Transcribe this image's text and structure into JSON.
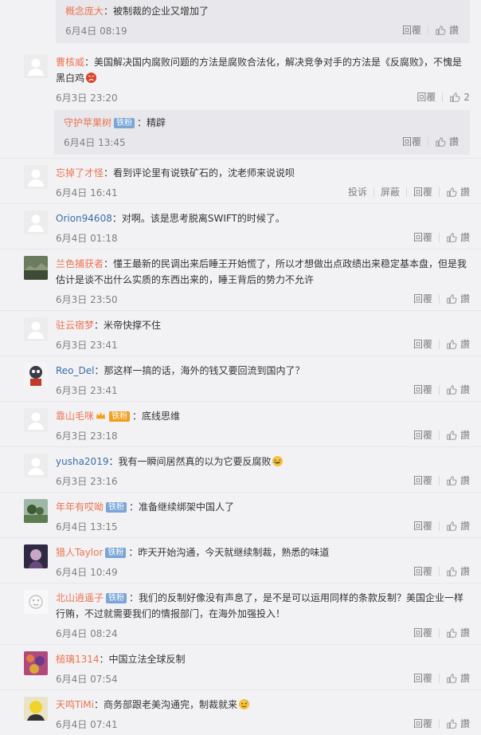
{
  "labels": {
    "reply": "回覆",
    "like": "讚",
    "report": "投诉",
    "block": "屏蔽"
  },
  "badge_iron_fan": "铁粉",
  "top_nested": {
    "user": "概念庞大",
    "text": "：被制裁的企业又增加了",
    "time": "6月4日 08:19"
  },
  "comments": [
    {
      "user": "曹核威",
      "text": "：美国解决国内腐败问题的方法是腐败合法化，解决竞争对手的方法是《反腐败》，不愧是黑白鸡",
      "time": "6月3日 23:20",
      "likes": "2",
      "nested": {
        "user": "守护苹果树",
        "text": "：精辟",
        "time": "6月4日 13:45"
      }
    },
    {
      "user": "忘掉了才怪",
      "text": "：看到评论里有说铁矿石的，沈老师来说说呗",
      "time": "6月4日 16:41"
    },
    {
      "user": "Orion94608",
      "text": "：对啊。该是思考脱离SWIFT的时候了。",
      "time": "6月4日 01:18"
    },
    {
      "user": "兰色捕获者",
      "text": "：懂王最新的民调出来后睡王开始慌了，所以才想做出点政绩出来稳定基本盘，但是我估计是谈不出什么实质的东西出来的，睡王背后的势力不允许",
      "time": "6月3日 23:50"
    },
    {
      "user": "驻云宿梦",
      "text": "：米帝快撑不住",
      "time": "6月3日 23:41"
    },
    {
      "user": "Reo_Del",
      "text": "：那这样一搞的话，海外的钱又要回流到国内了？",
      "time": "6月3日 23:41"
    },
    {
      "user": "靠山毛咪",
      "text": "：底线思维",
      "time": "6月3日 23:18",
      "gold_badge": "铁粉"
    },
    {
      "user": "yusha2019",
      "text": "：我有一瞬间居然真的以为它要反腐败",
      "time": "6月3日 23:16"
    },
    {
      "user": "年年有哎呦",
      "text": "：准备继续绑架中国人了",
      "time": "6月4日 13:15"
    },
    {
      "user": "猎人Taylor",
      "text": "：昨天开始沟通，今天就继续制裁，熟悉的味道",
      "time": "6月4日 10:49"
    },
    {
      "user": "北山逍遥子",
      "text": "：我们的反制好像没有声息了，是不是可以运用同样的条款反制？美国企业一样行贿，不过就需要我们的情报部门，在海外加强投入！",
      "time": "6月4日 08:24"
    },
    {
      "user": "槌璃1314",
      "text": "：中国立法全球反制",
      "time": "6月4日 07:54"
    },
    {
      "user": "天鸣TiMi",
      "text": "：商务部跟老美沟通完，制裁就来",
      "time": "6月4日 07:41"
    }
  ]
}
